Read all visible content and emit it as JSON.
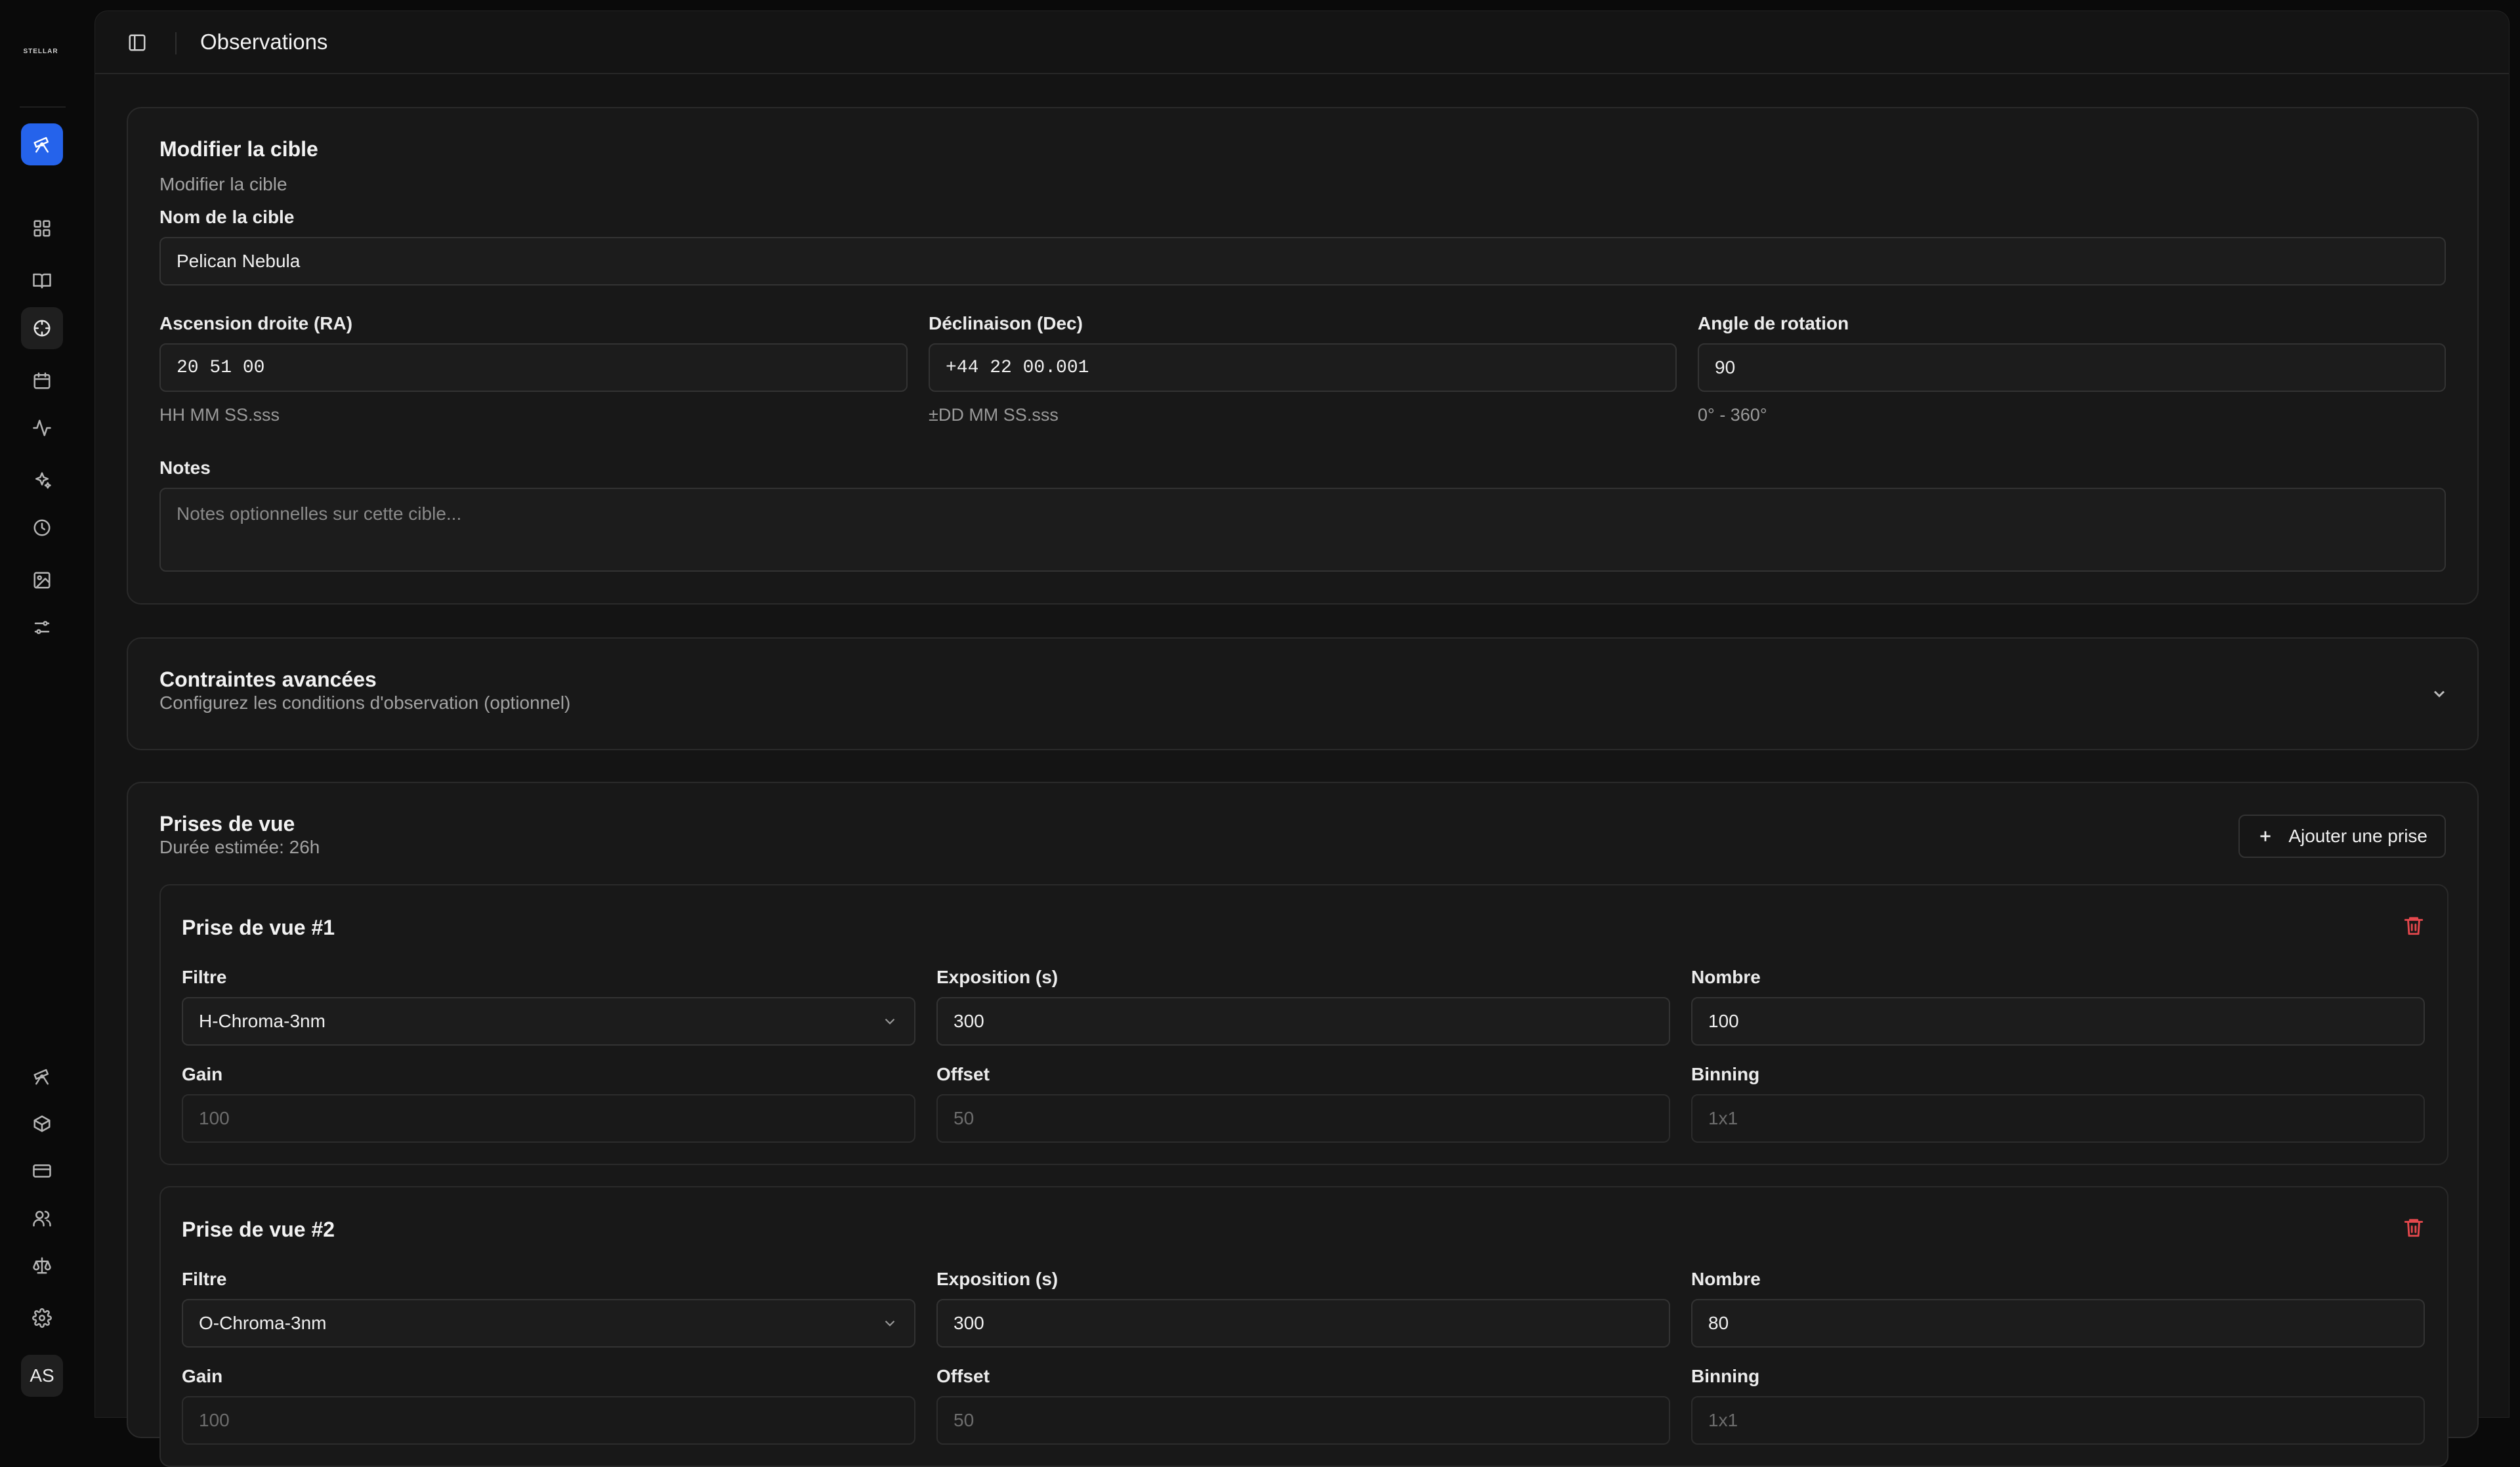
{
  "sidebar": {
    "logo_text": "STELLAR",
    "top_items": [
      {
        "name": "telescope-icon",
        "active": true
      },
      {
        "name": "dashboard-grid-icon"
      },
      {
        "name": "book-icon"
      },
      {
        "name": "crosshair-icon",
        "selected": true
      },
      {
        "name": "calendar-icon"
      },
      {
        "name": "activity-icon"
      },
      {
        "name": "sparkles-icon"
      },
      {
        "name": "history-clock-icon"
      },
      {
        "name": "image-icon"
      },
      {
        "name": "sliders-icon"
      }
    ],
    "bottom_items": [
      {
        "name": "telescope-icon"
      },
      {
        "name": "package-icon"
      },
      {
        "name": "credit-card-icon"
      },
      {
        "name": "users-icon"
      },
      {
        "name": "scale-icon"
      },
      {
        "name": "settings-gear-icon"
      }
    ],
    "avatar_initials": "AS"
  },
  "header": {
    "title": "Observations"
  },
  "target_card": {
    "title": "Modifier la cible",
    "subtitle": "Modifier la cible",
    "name_label": "Nom de la cible",
    "name_value": "Pelican Nebula",
    "ra_label": "Ascension droite (RA)",
    "ra_value": "20 51 00",
    "ra_hint": "HH MM SS.sss",
    "dec_label": "Déclinaison (Dec)",
    "dec_value": "+44 22 00.001",
    "dec_hint": "±DD MM SS.sss",
    "rotation_label": "Angle de rotation",
    "rotation_value": "90",
    "rotation_hint": "0° - 360°",
    "notes_label": "Notes",
    "notes_placeholder": "Notes optionnelles sur cette cible..."
  },
  "constraints_card": {
    "title": "Contraintes avancées",
    "subtitle": "Configurez les conditions d'observation (optionnel)"
  },
  "shots_card": {
    "title": "Prises de vue",
    "duration": "Durée estimée: 26h",
    "add_button": "Ajouter une prise",
    "shots": [
      {
        "title": "Prise de vue #1",
        "filter_label": "Filtre",
        "filter_value": "H-Chroma-3nm",
        "exposure_label": "Exposition (s)",
        "exposure_value": "300",
        "count_label": "Nombre",
        "count_value": "100",
        "gain_label": "Gain",
        "gain_value": "100",
        "offset_label": "Offset",
        "offset_value": "50",
        "binning_label": "Binning",
        "binning_value": "1x1"
      },
      {
        "title": "Prise de vue #2",
        "filter_label": "Filtre",
        "filter_value": "O-Chroma-3nm",
        "exposure_label": "Exposition (s)",
        "exposure_value": "300",
        "count_label": "Nombre",
        "count_value": "80",
        "gain_label": "Gain",
        "gain_value": "100",
        "offset_label": "Offset",
        "offset_value": "50",
        "binning_label": "Binning",
        "binning_value": "1x1"
      }
    ]
  },
  "colors": {
    "accent": "#2563eb",
    "danger": "#e5484d",
    "background": "#0a0a0a",
    "card": "#181818"
  }
}
